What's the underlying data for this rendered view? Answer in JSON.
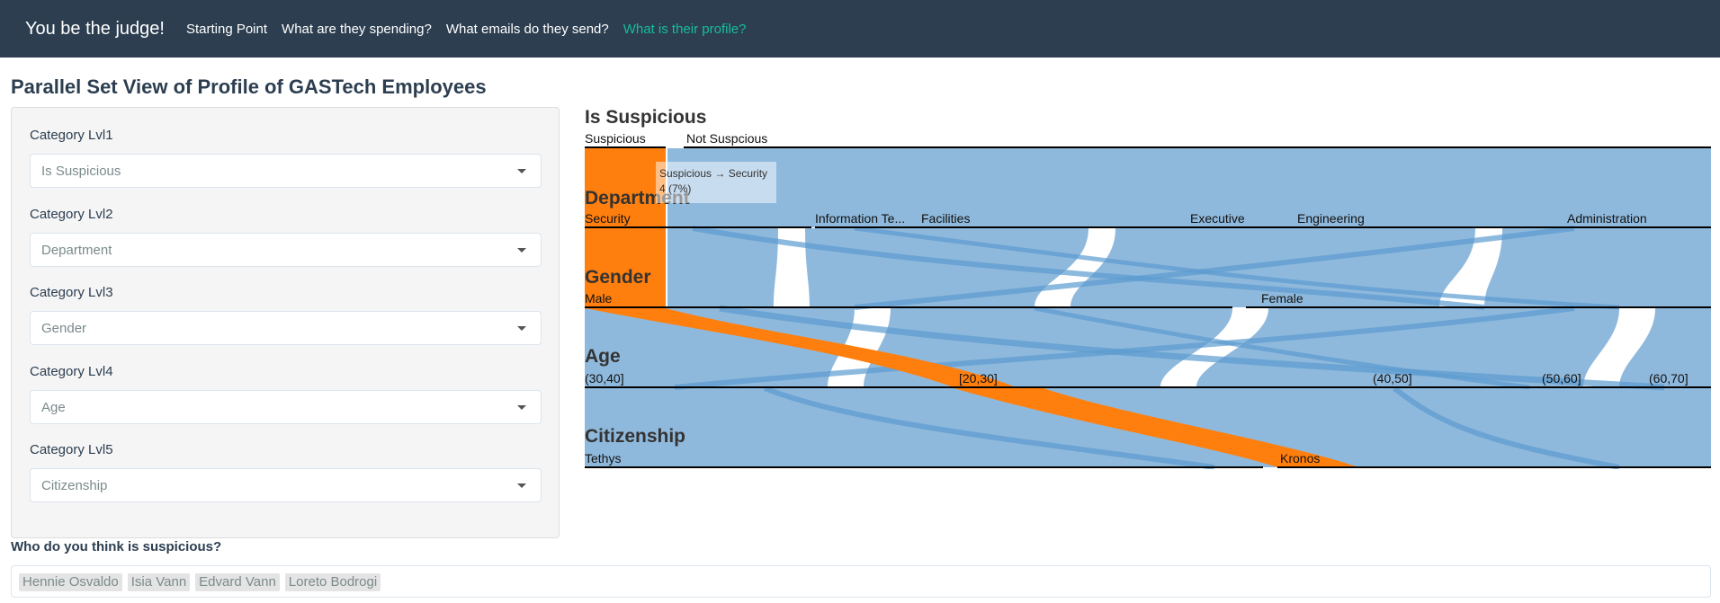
{
  "navbar": {
    "brand": "You be the judge!",
    "links": [
      {
        "label": "Starting Point",
        "active": false
      },
      {
        "label": "What are they spending?",
        "active": false
      },
      {
        "label": "What emails do they send?",
        "active": false
      },
      {
        "label": "What is their profile?",
        "active": true
      }
    ]
  },
  "page_title": "Parallel Set View of Profile of GASTech Employees",
  "sidebar": {
    "groups": [
      {
        "label": "Category Lvl1",
        "value": "Is Suspicious"
      },
      {
        "label": "Category Lvl2",
        "value": "Department"
      },
      {
        "label": "Category Lvl3",
        "value": "Gender"
      },
      {
        "label": "Category Lvl4",
        "value": "Age"
      },
      {
        "label": "Category Lvl5",
        "value": "Citizenship"
      }
    ]
  },
  "chart": {
    "dimensions": [
      {
        "title": "Is Suspicious",
        "categories": [
          "Suspicious",
          "Not Suspcious"
        ]
      },
      {
        "title": "Department",
        "categories": [
          "Security",
          "Information Te...",
          "Facilities",
          "Executive",
          "Engineering",
          "Administration"
        ]
      },
      {
        "title": "Gender",
        "categories": [
          "Male",
          "Female"
        ]
      },
      {
        "title": "Age",
        "categories": [
          "(30,40]",
          "[20,30]",
          "(40,50]",
          "(50,60]",
          "(60,70]"
        ]
      },
      {
        "title": "Citizenship",
        "categories": [
          "Tethys",
          "Kronos"
        ]
      }
    ],
    "tooltip": {
      "line1": "Suspicious → Security",
      "line2": "4 (7%)"
    },
    "colors": {
      "highlight": "#ff7f0e",
      "base": "#5b9bd0",
      "ribbon": "#8fb9dc",
      "axis": "#000000"
    }
  },
  "suspicious": {
    "label": "Who do you think is suspicious?",
    "tags": [
      "Hennie Osvaldo",
      "Isia Vann",
      "Edvard Vann",
      "Loreto Bodrogi"
    ]
  }
}
